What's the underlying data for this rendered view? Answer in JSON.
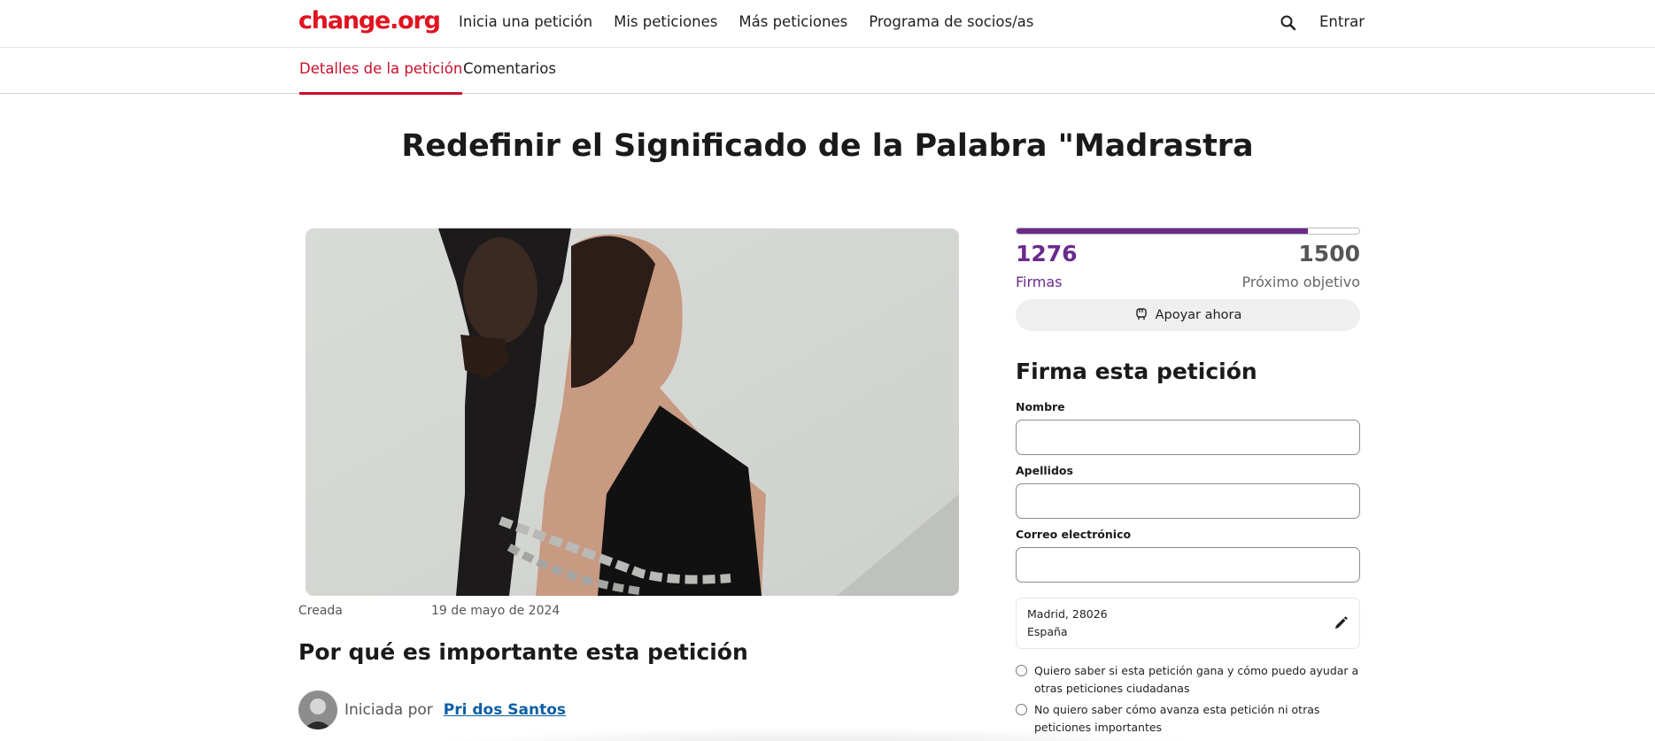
{
  "header": {
    "logo": "change.org",
    "nav": [
      "Inicia una petición",
      "Mis peticiones",
      "Más peticiones",
      "Programa de socios/as"
    ],
    "login": "Entrar",
    "search_icon": "search-icon"
  },
  "tabs": [
    "Detalles de la petición",
    "Comentarios"
  ],
  "petition": {
    "title": "Redefinir el Significado de la Palabra \"Madrastra",
    "created_label": "Creada",
    "created_date": "19 de mayo de 2024",
    "why_heading": "Por qué es importante esta petición",
    "started_by": "Iniciada por",
    "author": "Pri dos Santos"
  },
  "signatures": {
    "count": "1276",
    "count_label": "Firmas",
    "goal": "1500",
    "goal_label": "Próximo objetivo",
    "progress_fraction": 0.851,
    "support_button": "Apoyar ahora"
  },
  "form": {
    "title": "Firma esta petición",
    "first_name_label": "Nombre",
    "last_name_label": "Apellidos",
    "email_label": "Correo electrónico",
    "location_line1": "Madrid, 28026",
    "location_line2": "España",
    "option_yes": "Quiero saber si esta petición gana y cómo puedo ayudar a otras peticiones ciudadanas",
    "option_no": "No quiero saber cómo avanza esta petición ni otras peticiones importantes"
  },
  "colors": {
    "brand": "#e2121f",
    "accent_purple": "#6b2a8c",
    "link": "#0d5fa6"
  }
}
